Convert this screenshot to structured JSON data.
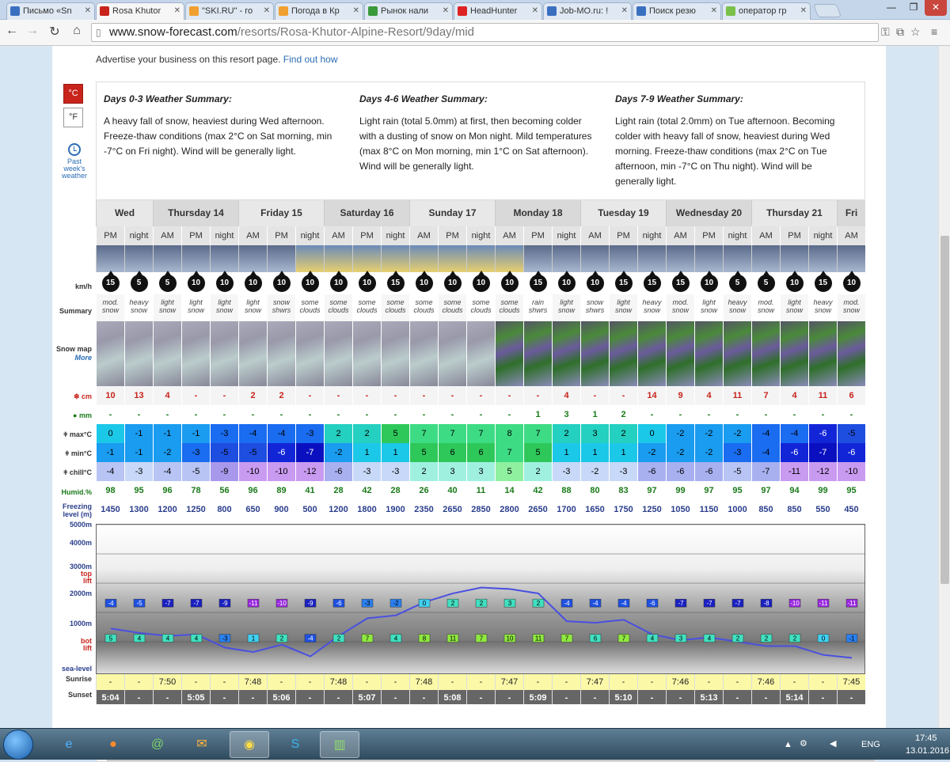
{
  "browser": {
    "tabs": [
      {
        "title": "Письмо «Sn",
        "color": "#3a6fc0"
      },
      {
        "title": "Rosa Khutor",
        "color": "#c8241c",
        "active": true
      },
      {
        "title": "\"SKI.RU\" - го",
        "color": "#f0a030"
      },
      {
        "title": "Погода в Кр",
        "color": "#f0a030"
      },
      {
        "title": "Рынок нали",
        "color": "#3a9a3a"
      },
      {
        "title": "HeadHunter",
        "color": "#d22"
      },
      {
        "title": "Job-MO.ru: !",
        "color": "#3a6fc0"
      },
      {
        "title": "Поиск резю",
        "color": "#3a6fc0"
      },
      {
        "title": "оператор гр",
        "color": "#7ac04a"
      }
    ],
    "url_host": "www.snow-forecast.com",
    "url_path": "/resorts/Rosa-Khutor-Alpine-Resort/9day/mid",
    "icons": [
      "back-icon",
      "forward-icon",
      "reload-icon",
      "home-icon",
      "page-icon",
      "key-icon",
      "translate-icon",
      "star-icon",
      "menu-icon"
    ]
  },
  "advert": {
    "text": "Advertise your business on this resort page. ",
    "link": "Find out how"
  },
  "units": {
    "c": "°C",
    "f": "°F"
  },
  "past": {
    "label1": "Past",
    "label2": "week's",
    "label3": "weather"
  },
  "summaries": [
    {
      "title": "Days 0-3 Weather Summary:",
      "text": "A heavy fall of snow, heaviest during Wed afternoon. Freeze-thaw conditions (max 2°C on Sat morning, min -7°C on Fri night). Wind will be generally light."
    },
    {
      "title": "Days 4-6 Weather Summary:",
      "text": "Light rain (total 5.0mm) at first, then becoming colder with a dusting of snow on Mon night. Mild temperatures (max 8°C on Mon morning, min 1°C on Sat afternoon). Wind will be generally light."
    },
    {
      "title": "Days 7-9 Weather Summary:",
      "text": "Light rain (total 2.0mm) on Tue afternoon. Becoming colder with heavy fall of snow, heaviest during Wed morning. Freeze-thaw conditions (max 2°C on Tue afternoon, min -7°C on Thu night). Wind will be generally light."
    }
  ],
  "row_labels": {
    "kmh": "km/h",
    "summary": "Summary",
    "snowmap": "Snow map",
    "more": "More",
    "snow": "cm",
    "rain": "mm",
    "max": "max°C",
    "min": "min°C",
    "chill": "chill°C",
    "humid": "Humid.%",
    "freezing1": "Freezing",
    "freezing2": "level (m)",
    "e5000": "5000m",
    "e4000": "4000m",
    "e3000": "3000m",
    "top1": "top",
    "top2": "lift",
    "e2000": "2000m",
    "e1000": "1000m",
    "bot1": "bot",
    "bot2": "lift",
    "sea": "sea-level",
    "sunrise": "Sunrise",
    "sunset": "Sunset"
  },
  "days": [
    {
      "name": "Wed",
      "span": 2
    },
    {
      "name": "Thursday 14",
      "span": 3
    },
    {
      "name": "Friday 15",
      "span": 3
    },
    {
      "name": "Saturday 16",
      "span": 3
    },
    {
      "name": "Sunday 17",
      "span": 3
    },
    {
      "name": "Monday 18",
      "span": 3
    },
    {
      "name": "Tuesday 19",
      "span": 3
    },
    {
      "name": "Wednesday 20",
      "span": 3
    },
    {
      "name": "Thursday 21",
      "span": 3
    },
    {
      "name": "Fri",
      "span": 1
    }
  ],
  "periods": [
    "PM",
    "night",
    "AM",
    "PM",
    "night",
    "AM",
    "PM",
    "night",
    "AM",
    "PM",
    "night",
    "AM",
    "PM",
    "night",
    "AM",
    "PM",
    "night",
    "AM",
    "PM",
    "night",
    "AM",
    "PM",
    "night",
    "AM",
    "PM",
    "night",
    "AM"
  ],
  "wind": [
    15,
    5,
    5,
    10,
    10,
    10,
    10,
    10,
    10,
    10,
    15,
    10,
    10,
    10,
    10,
    15,
    10,
    10,
    15,
    15,
    15,
    10,
    5,
    5,
    10,
    15,
    10
  ],
  "summary_text": [
    "mod. snow",
    "heavy snow",
    "light snow",
    "light snow",
    "light snow",
    "light snow",
    "snow shwrs",
    "some clouds",
    "some clouds",
    "some clouds",
    "some clouds",
    "some clouds",
    "some clouds",
    "some clouds",
    "some clouds",
    "rain shwrs",
    "light snow",
    "snow shwrs",
    "light snow",
    "heavy snow",
    "mod. snow",
    "light snow",
    "heavy snow",
    "mod. snow",
    "light snow",
    "heavy snow",
    "mod. snow"
  ],
  "snowmap_green": [
    0,
    0,
    0,
    0,
    0,
    0,
    0,
    0,
    0,
    0,
    0,
    0,
    0,
    0,
    1,
    1,
    1,
    1,
    1,
    1,
    1,
    1,
    1,
    1,
    1,
    1,
    1
  ],
  "snow_cm": [
    "10",
    "13",
    "4",
    "-",
    "-",
    "2",
    "2",
    "-",
    "-",
    "-",
    "-",
    "-",
    "-",
    "-",
    "-",
    "-",
    "4",
    "-",
    "-",
    "14",
    "9",
    "4",
    "11",
    "7",
    "4",
    "11",
    "6"
  ],
  "rain_mm": [
    "-",
    "-",
    "-",
    "-",
    "-",
    "-",
    "-",
    "-",
    "-",
    "-",
    "-",
    "-",
    "-",
    "-",
    "-",
    "1",
    "3",
    "1",
    "2",
    "-",
    "-",
    "-",
    "-",
    "-",
    "-",
    "-",
    "-"
  ],
  "max_c": [
    0,
    -1,
    -1,
    -1,
    -3,
    -4,
    -4,
    -3,
    2,
    2,
    5,
    7,
    7,
    7,
    8,
    7,
    2,
    3,
    2,
    0,
    -2,
    -2,
    -2,
    -4,
    -4,
    -6,
    -5
  ],
  "min_c": [
    -1,
    -1,
    -2,
    -3,
    -5,
    -5,
    -6,
    -7,
    -2,
    1,
    1,
    5,
    6,
    6,
    7,
    5,
    1,
    1,
    1,
    -2,
    -2,
    -2,
    -3,
    -4,
    -6,
    -7,
    -6
  ],
  "chill_c": [
    -4,
    -3,
    -4,
    -5,
    -9,
    -10,
    -10,
    -12,
    -6,
    -3,
    -3,
    2,
    3,
    3,
    5,
    2,
    -3,
    -2,
    -3,
    -6,
    -6,
    -6,
    -5,
    -7,
    -11,
    -12,
    -10
  ],
  "humid": [
    98,
    95,
    96,
    78,
    56,
    96,
    89,
    41,
    28,
    42,
    28,
    26,
    40,
    11,
    14,
    42,
    88,
    80,
    83,
    97,
    99,
    97,
    95,
    97,
    94,
    99,
    95
  ],
  "freezing": [
    1450,
    1300,
    1200,
    1250,
    800,
    650,
    900,
    500,
    1200,
    1800,
    1900,
    2350,
    2650,
    2850,
    2800,
    2650,
    1700,
    1650,
    1750,
    1250,
    1050,
    1150,
    1000,
    850,
    850,
    550,
    450
  ],
  "top_lift": [
    -4,
    -5,
    -7,
    -7,
    -9,
    -11,
    -10,
    -9,
    -6,
    -3,
    -2,
    0,
    2,
    2,
    3,
    2,
    -4,
    -4,
    -4,
    -6,
    -7,
    -7,
    -7,
    -8,
    -10,
    -11,
    -11
  ],
  "bot_lift": [
    5,
    4,
    4,
    4,
    -3,
    1,
    2,
    -4,
    2,
    7,
    4,
    8,
    11,
    7,
    10,
    11,
    7,
    6,
    7,
    4,
    3,
    4,
    2,
    2,
    2,
    0,
    -1
  ],
  "sunrise": [
    "-",
    "-",
    "7:50",
    "-",
    "-",
    "7:48",
    "-",
    "-",
    "7:48",
    "-",
    "-",
    "7:48",
    "-",
    "-",
    "7:47",
    "-",
    "-",
    "7:47",
    "-",
    "-",
    "7:46",
    "-",
    "-",
    "7:46",
    "-",
    "-",
    "7:45"
  ],
  "sunset": [
    "5:04",
    "-",
    "-",
    "5:05",
    "-",
    "-",
    "5:06",
    "-",
    "-",
    "5:07",
    "-",
    "-",
    "5:08",
    "-",
    "-",
    "5:09",
    "-",
    "-",
    "5:10",
    "-",
    "-",
    "5:13",
    "-",
    "-",
    "5:14",
    "-",
    "-"
  ],
  "taskbar": {
    "lang": "ENG",
    "time": "17:45",
    "date": "13.01.2016"
  }
}
